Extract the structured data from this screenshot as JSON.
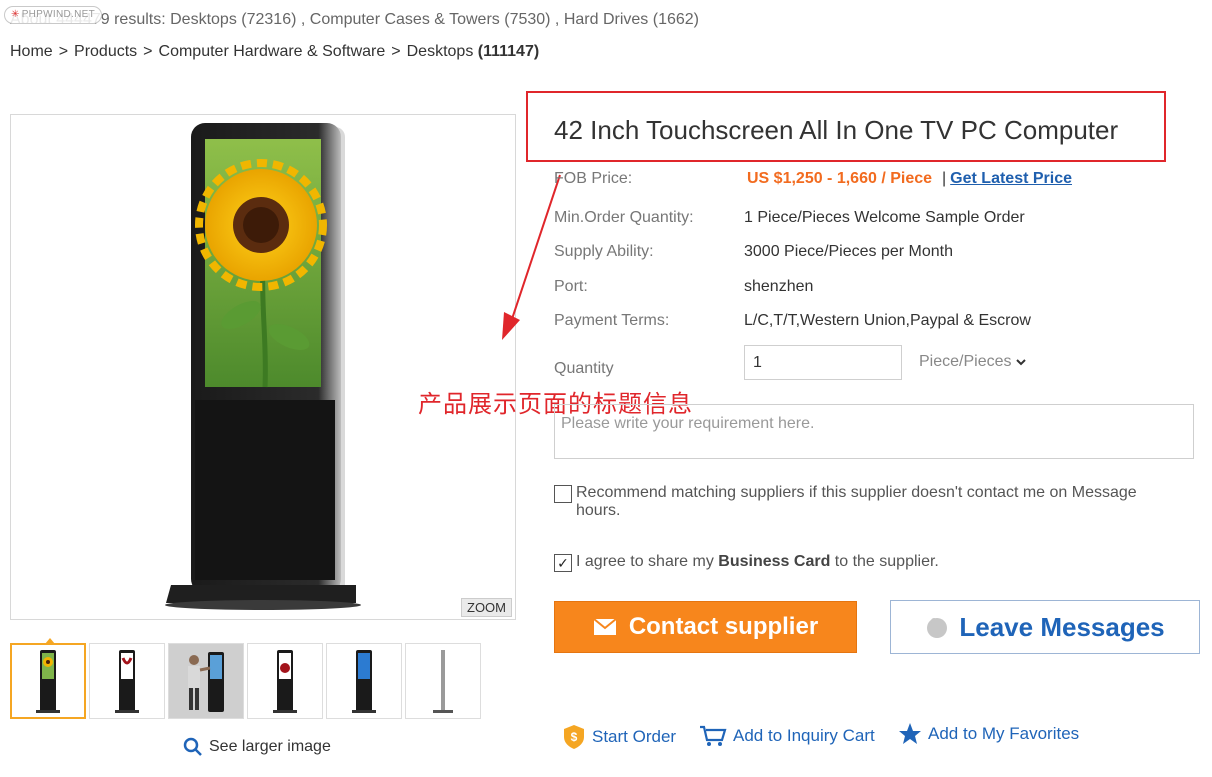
{
  "watermark": "PHPWIND.NET",
  "results": {
    "prefix": "About 444479 results:",
    "categories": [
      {
        "name": "Desktops",
        "count": "(72316)"
      },
      {
        "name": "Computer Cases & Towers",
        "count": "(7530)"
      },
      {
        "name": "Hard Drives",
        "count": "(1662)"
      }
    ]
  },
  "breadcrumb": {
    "items": [
      "Home",
      "Products",
      "Computer Hardware & Software",
      "Desktops"
    ],
    "separator": ">",
    "count": "(111147)"
  },
  "gallery": {
    "zoom_label": "ZOOM",
    "see_larger_label": "See larger image",
    "thumbnails": [
      "thumb-1",
      "thumb-2",
      "thumb-3",
      "thumb-4",
      "thumb-5",
      "thumb-6"
    ]
  },
  "product": {
    "title": "42 Inch Touchscreen All In One TV PC Computer",
    "fob_label": "FOB Price:",
    "price": "US $1,250 - 1,660 / Piece",
    "price_separator": "|",
    "latest_price_link": "Get Latest Price",
    "min_order_label": "Min.Order Quantity:",
    "min_order_value": "1 Piece/Pieces Welcome Sample Order",
    "supply_label": "Supply Ability:",
    "supply_value": "3000 Piece/Pieces per Month",
    "port_label": "Port:",
    "port_value": "shenzhen",
    "payment_label": "Payment Terms:",
    "payment_value": "L/C,T/T,Western Union,Paypal & Escrow"
  },
  "form": {
    "quantity_label": "Quantity",
    "quantity_value": "1",
    "unit": "Piece/Pieces",
    "requirement_placeholder": "Please write your requirement here.",
    "recommend_line1": "Recommend matching suppliers if this supplier doesn't contact me on Message",
    "recommend_line2": "hours.",
    "recommend_checked": false,
    "agree_prefix": "I agree to share my",
    "agree_bold": "Business Card",
    "agree_suffix": "to the supplier.",
    "agree_checked": true
  },
  "buttons": {
    "contact": "Contact supplier",
    "leave": "Leave Messages"
  },
  "actions": {
    "start_order": "Start Order",
    "inquiry_cart": "Add to Inquiry Cart",
    "favorites": "Add to My Favorites"
  },
  "annotation": {
    "text": "产品展示页面的标题信息",
    "color": "#e0262b"
  },
  "colors": {
    "accent_orange": "#f7861c",
    "price_orange": "#f26b1f",
    "link_blue": "#1f64b8",
    "highlight_red": "#e0262b"
  }
}
